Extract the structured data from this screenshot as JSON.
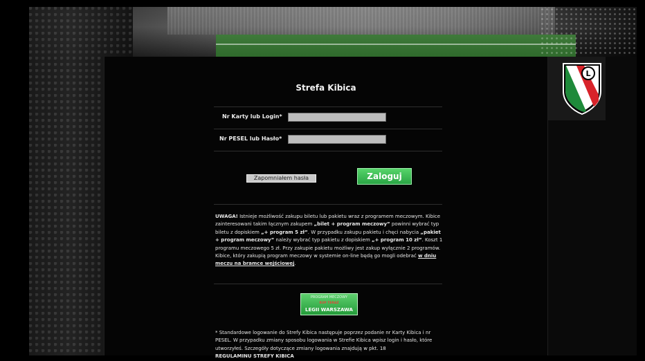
{
  "page": {
    "title": "Strefa Kibica"
  },
  "form": {
    "login_label": "Nr Karty lub Login*",
    "login_value": "",
    "password_label": "Nr PESEL lub Hasło*",
    "password_value": "",
    "forgot_label": "Zapomniałem hasła",
    "submit_label": "Zaloguj"
  },
  "notice": {
    "strong": "UWAGA!",
    "t1": " Istnieje możliwość zakupu biletu lub pakietu wraz z programem meczowym. Kibice zainteresowani takim łącznym zakupem ",
    "b1": "„bilet + program meczowy”",
    "t2": " powinni wybrać typ biletu z dopiskiem ",
    "b2": "„+ program 5 zł”",
    "t3": ". W przypadku zakupu pakietu i chęci nabycia ",
    "b3": "„pakiet + program meczowy”",
    "t4": " należy wybrać typ pakietu z dopiskiem ",
    "b4": "„+ program 10 zł”",
    "t5": ". Koszt 1 programu meczowego 5 zł. Przy zakupie pakietu możliwy jest zakup wyłącznie 2 programów. Kibice, który zakupią program meczowy w systemie on-line będą go mogli odebrać ",
    "u1": "w dniu meczu na bramce wejściowej",
    "t6": "."
  },
  "promo": {
    "line1": "PROGRAM MECZOWY",
    "line2": "KUP TERAZ",
    "line3": "LEGII WARSZAWA"
  },
  "footer_note": {
    "text": "* Standardowe logowanie do Strefy Kibica następuje poprzez podanie nr Karty Kibica i nr PESEL. W przypadku zmiany sposobu logowania w Strefie Kibica wpisz login i hasło, które utworzyłeś. Szczegóły dotyczące zmiany logowania znajdują w pkt. 18",
    "bold": "REGULAMINU STREFY KIBICA"
  },
  "logo": {
    "letter": "L",
    "colors": {
      "white": "#ffffff",
      "green": "#1e8a3a",
      "red": "#d8232a",
      "black": "#000000"
    }
  }
}
